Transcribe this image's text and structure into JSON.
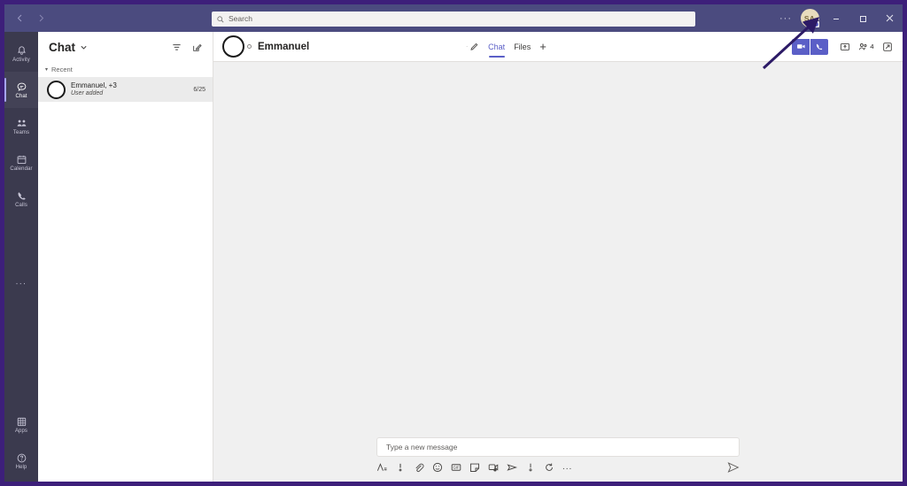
{
  "window": {
    "nav_back": "back-arrow",
    "nav_forward": "forward-arrow",
    "minimize_label": "Minimize",
    "maximize_label": "Restore",
    "close_label": "Close",
    "more_label": "Settings and more",
    "title_bar_color": "#4b4b7f",
    "frame_color": "#3d1f7a"
  },
  "search": {
    "placeholder": "Search",
    "value": ""
  },
  "account": {
    "initials": "SA",
    "avatar_color": "#e8dcbd",
    "status": "available"
  },
  "rail": {
    "items": [
      {
        "label": "Activity",
        "icon": "bell-icon",
        "active": false
      },
      {
        "label": "Chat",
        "icon": "chat-bubble-icon",
        "active": true
      },
      {
        "label": "Teams",
        "icon": "teams-people-icon",
        "active": false
      },
      {
        "label": "Calendar",
        "icon": "calendar-icon",
        "active": false
      },
      {
        "label": "Calls",
        "icon": "phone-icon",
        "active": false
      }
    ],
    "more_label": "...",
    "bottom_items": [
      {
        "label": "Apps",
        "icon": "apps-grid-icon"
      },
      {
        "label": "Help",
        "icon": "help-question-icon"
      }
    ]
  },
  "chat_list": {
    "title": "Chat",
    "chevron": "chevron-down-icon",
    "filter_label": "Filter",
    "new_chat_label": "New chat",
    "section_label": "Recent",
    "items": [
      {
        "name": "Emmanuel, +3",
        "preview": "User added",
        "time": "6/25",
        "selected": true
      }
    ]
  },
  "conversation": {
    "title": "Emmanuel",
    "pencil_label": "Edit name",
    "tabs": [
      {
        "label": "Chat",
        "active": true
      },
      {
        "label": "Files",
        "active": false
      }
    ],
    "add_tab_label": "+",
    "video_call_label": "Video call",
    "audio_call_label": "Audio call",
    "share_label": "Share screen",
    "participants_count": "4",
    "popout_label": "Pop out chat",
    "accent_color": "#5b5fc7"
  },
  "compose": {
    "placeholder": "Type a new message",
    "value": "",
    "tools": [
      "format-icon",
      "set-delivery-options-icon",
      "attach-file-icon",
      "emoji-icon",
      "giphy-icon",
      "sticker-icon",
      "meet-now-icon",
      "stream-icon",
      "praise-icon",
      "loop-icon"
    ],
    "more_label": "...",
    "send_label": "Send"
  }
}
